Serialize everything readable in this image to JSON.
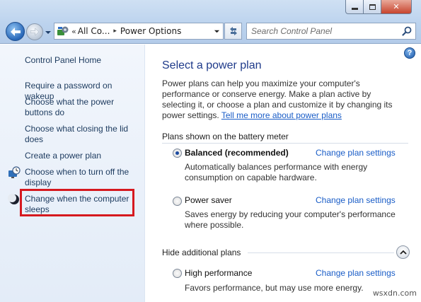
{
  "window": {
    "minimize_icon": "minimize-icon",
    "maximize_icon": "maximize-icon",
    "close_icon": "close-icon"
  },
  "address": {
    "chevrons": "«",
    "crumbs": [
      "All Co...",
      "Power Options"
    ],
    "separator": "▸"
  },
  "search": {
    "placeholder": "Search Control Panel"
  },
  "sidebar": {
    "home": "Control Panel Home",
    "items": [
      {
        "label": "Require a password on wakeup",
        "icon": ""
      },
      {
        "label": "Choose what the power buttons do",
        "icon": ""
      },
      {
        "label": "Choose what closing the lid does",
        "icon": ""
      },
      {
        "label": "Create a power plan",
        "icon": ""
      },
      {
        "label": "Choose when to turn off the display",
        "icon": "display-clock-icon"
      },
      {
        "label": "Change when the computer sleeps",
        "icon": "moon-icon"
      }
    ]
  },
  "main": {
    "title": "Select a power plan",
    "intro": "Power plans can help you maximize your computer's performance or conserve energy. Make a plan active by selecting it, or choose a plan and customize it by changing its power settings. ",
    "intro_link": "Tell me more about power plans",
    "group1_header": "Plans shown on the battery meter",
    "group2_header": "Hide additional plans",
    "plans": [
      {
        "name": "Balanced (recommended)",
        "selected": true,
        "link": "Change plan settings",
        "desc": "Automatically balances performance with energy consumption on capable hardware."
      },
      {
        "name": "Power saver",
        "selected": false,
        "link": "Change plan settings",
        "desc": "Saves energy by reducing your computer's performance where possible."
      },
      {
        "name": "High performance",
        "selected": false,
        "link": "Change plan settings",
        "desc": "Favors performance, but may use more energy."
      }
    ]
  },
  "watermark": "wsxdn.com",
  "colors": {
    "link": "#1a5dc7",
    "title": "#1e3a8a",
    "highlight": "#d6191f"
  }
}
